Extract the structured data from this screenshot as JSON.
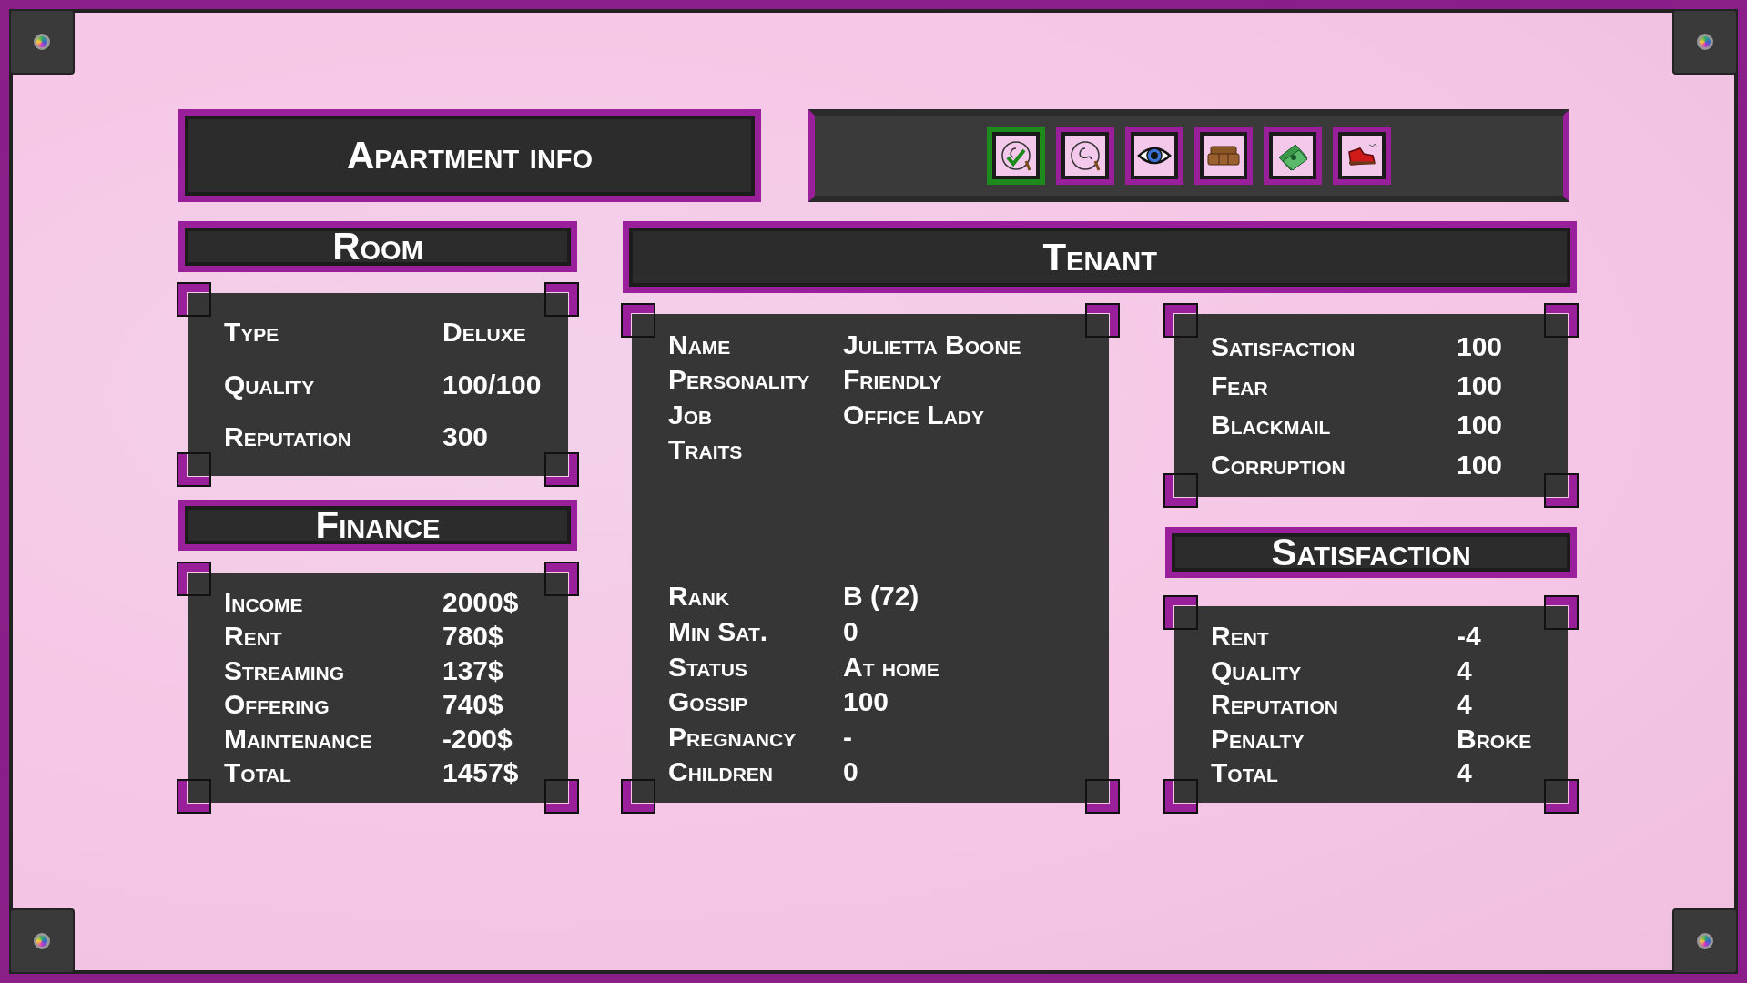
{
  "title": "Apartment info",
  "toolbar": [
    {
      "kind": "whip-check",
      "selected": true
    },
    {
      "kind": "whip",
      "selected": false
    },
    {
      "kind": "eye",
      "selected": false
    },
    {
      "kind": "couch",
      "selected": false
    },
    {
      "kind": "money",
      "selected": false
    },
    {
      "kind": "boot",
      "selected": false
    }
  ],
  "room": {
    "title": "Room",
    "rows": [
      {
        "label": "Type",
        "value": "Deluxe"
      },
      {
        "label": "Quality",
        "value": "100/100"
      },
      {
        "label": "Reputation",
        "value": "300"
      }
    ]
  },
  "finance": {
    "title": "Finance",
    "rows": [
      {
        "label": "Income",
        "value": "2000$"
      },
      {
        "label": "Rent",
        "value": "780$"
      },
      {
        "label": "Streaming",
        "value": "137$"
      },
      {
        "label": "Offering",
        "value": "740$"
      },
      {
        "label": "Maintenance",
        "value": "-200$"
      },
      {
        "label": "Total",
        "value": "1457$"
      }
    ]
  },
  "tenant": {
    "title": "Tenant",
    "rows": [
      {
        "label": "Name",
        "value": "Julietta Boone"
      },
      {
        "label": "Personality",
        "value": "Friendly"
      },
      {
        "label": "Job",
        "value": "Office Lady"
      },
      {
        "label": "Traits"
      },
      {
        "label": "Rank",
        "value": "B (72)"
      },
      {
        "label": "Min Sat.",
        "value": "0"
      },
      {
        "label": "Status",
        "value": "At home"
      },
      {
        "label": "Gossip",
        "value": "100"
      },
      {
        "label": "Pregnancy",
        "value": "-"
      },
      {
        "label": "Children",
        "value": "0"
      }
    ]
  },
  "stats": {
    "rows": [
      {
        "label": "Satisfaction",
        "value": "100"
      },
      {
        "label": "Fear",
        "value": "100"
      },
      {
        "label": "Blackmail",
        "value": "100"
      },
      {
        "label": "Corruption",
        "value": "100"
      }
    ]
  },
  "satisfaction": {
    "title": "Satisfaction",
    "rows": [
      {
        "label": "Rent",
        "value": "-4"
      },
      {
        "label": "Quality",
        "value": "4"
      },
      {
        "label": "Reputation",
        "value": "4"
      },
      {
        "label": "Penalty",
        "value": "Broke"
      },
      {
        "label": "Total",
        "value": "4"
      }
    ]
  }
}
